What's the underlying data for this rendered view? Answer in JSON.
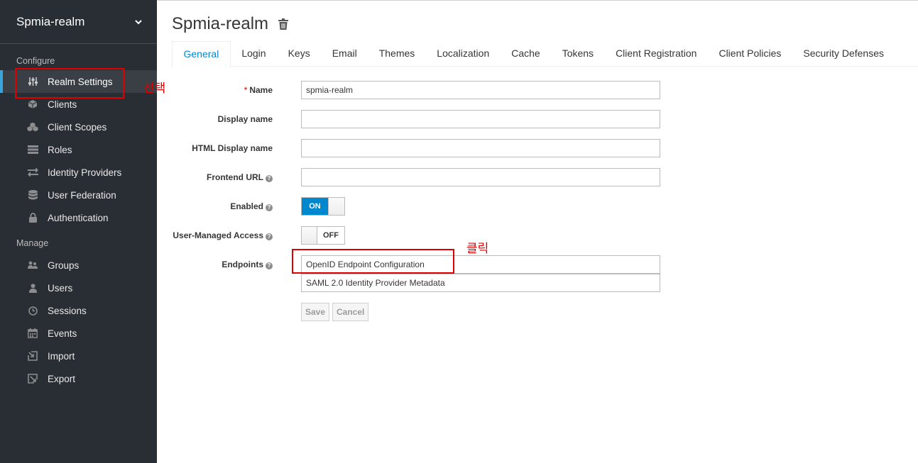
{
  "realm_selector": {
    "name": "Spmia-realm"
  },
  "sidebar": {
    "configure_heading": "Configure",
    "configure_items": [
      {
        "label": "Realm Settings",
        "icon": "sliders-icon",
        "active": true
      },
      {
        "label": "Clients",
        "icon": "cube-icon"
      },
      {
        "label": "Client Scopes",
        "icon": "cubes-icon"
      },
      {
        "label": "Roles",
        "icon": "list-icon"
      },
      {
        "label": "Identity Providers",
        "icon": "exchange-icon"
      },
      {
        "label": "User Federation",
        "icon": "database-icon"
      },
      {
        "label": "Authentication",
        "icon": "lock-icon"
      }
    ],
    "manage_heading": "Manage",
    "manage_items": [
      {
        "label": "Groups",
        "icon": "users-icon"
      },
      {
        "label": "Users",
        "icon": "user-icon"
      },
      {
        "label": "Sessions",
        "icon": "clock-icon"
      },
      {
        "label": "Events",
        "icon": "calendar-icon"
      },
      {
        "label": "Import",
        "icon": "import-icon"
      },
      {
        "label": "Export",
        "icon": "export-icon"
      }
    ]
  },
  "page": {
    "title": "Spmia-realm"
  },
  "tabs": [
    {
      "label": "General",
      "active": true
    },
    {
      "label": "Login"
    },
    {
      "label": "Keys"
    },
    {
      "label": "Email"
    },
    {
      "label": "Themes"
    },
    {
      "label": "Localization"
    },
    {
      "label": "Cache"
    },
    {
      "label": "Tokens"
    },
    {
      "label": "Client Registration"
    },
    {
      "label": "Client Policies"
    },
    {
      "label": "Security Defenses"
    }
  ],
  "form": {
    "name_label": "Name",
    "name_required_mark": "*",
    "name_value": "spmia-realm",
    "display_name_label": "Display name",
    "display_name_value": "",
    "html_display_name_label": "HTML Display name",
    "html_display_name_value": "",
    "frontend_url_label": "Frontend URL",
    "frontend_url_value": "",
    "enabled_label": "Enabled",
    "enabled_state": "ON",
    "user_managed_access_label": "User-Managed Access",
    "user_managed_access_state": "OFF",
    "endpoints_label": "Endpoints",
    "endpoints": [
      "OpenID Endpoint Configuration",
      "SAML 2.0 Identity Provider Metadata"
    ],
    "save_label": "Save",
    "cancel_label": "Cancel",
    "help_glyph": "?"
  },
  "annotations": {
    "select_text": "선택",
    "click_text": "클릭",
    "color": "#e00000"
  },
  "colors": {
    "sidebar_bg": "#292e34",
    "accent": "#0088ce",
    "active_bar": "#39a5dc"
  }
}
